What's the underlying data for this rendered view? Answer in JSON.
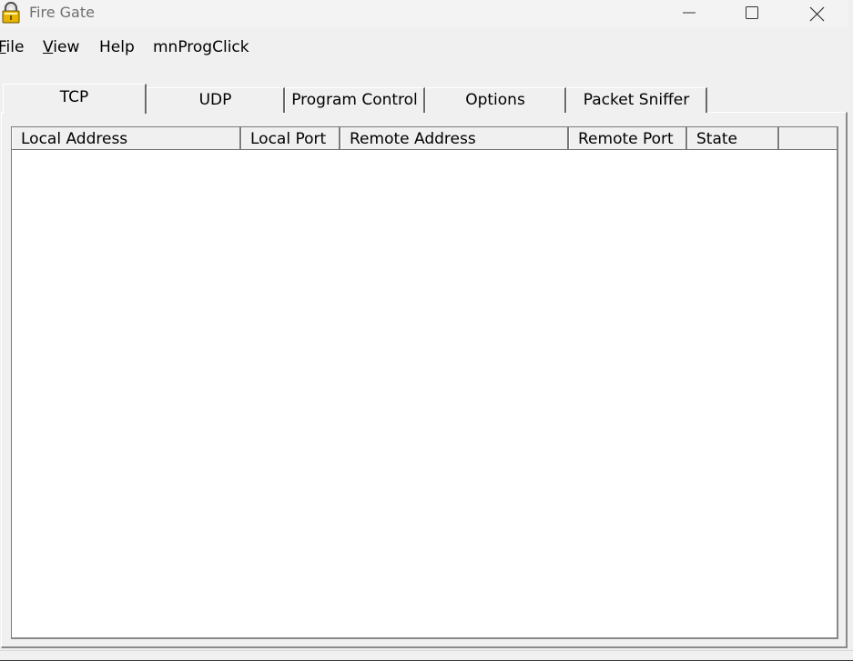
{
  "window": {
    "title": "Fire Gate",
    "icon": "padlock-icon"
  },
  "menu": {
    "file": "File",
    "view": "View",
    "help": "Help",
    "prog": "mnProgClick"
  },
  "tabs": [
    {
      "label": "TCP",
      "active": true
    },
    {
      "label": "UDP",
      "active": false
    },
    {
      "label": "Program Control",
      "active": false
    },
    {
      "label": "Options",
      "active": false
    },
    {
      "label": "Packet Sniffer",
      "active": false
    }
  ],
  "table": {
    "columns": [
      "Local Address",
      "Local Port",
      "Remote Address",
      "Remote Port",
      "State",
      ""
    ],
    "rows": []
  },
  "colors": {
    "window_bg": "#f0f0f0",
    "list_bg": "#ffffff",
    "title_text": "#6f6f6f",
    "lock_gold": "#e8b400"
  }
}
